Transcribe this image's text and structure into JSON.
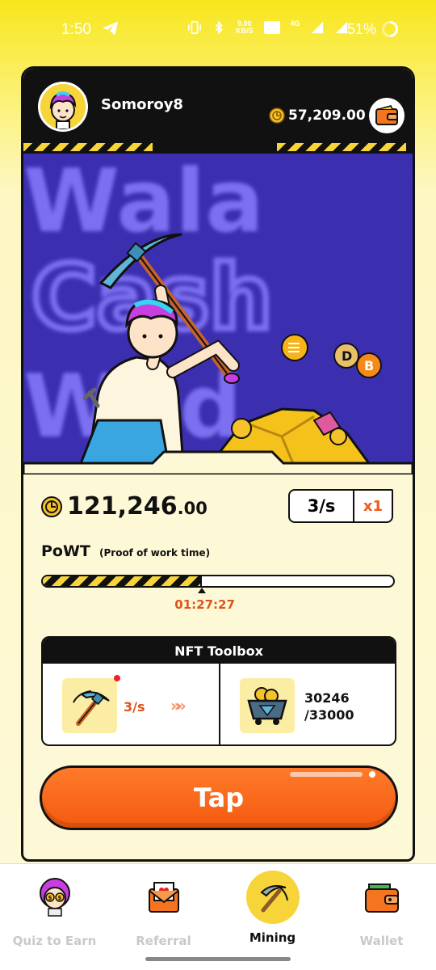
{
  "status_bar": {
    "time": "1:50",
    "net_speed_value": "9.00",
    "net_speed_unit": "KB/S",
    "signal": "4G",
    "battery": "51%"
  },
  "header": {
    "username": "Somoroy8",
    "balance": "57,209.00"
  },
  "hero": {
    "background_text": [
      "Wala",
      "Cash",
      "Wild"
    ]
  },
  "mining": {
    "mined_integer": "121,246",
    "mined_decimal": ".00",
    "rate": "3/s",
    "multiplier": "x1"
  },
  "powt": {
    "title": "PoWT",
    "subtitle": "(Proof of work time)",
    "progress_fraction": 0.455,
    "time_remaining": "01:27:27"
  },
  "toolbox": {
    "title": "NFT Toolbox",
    "tool_rate": "3/s",
    "arrows": "»»",
    "capacity_current": "30246",
    "capacity_max": "/33000"
  },
  "tap_label": "Tap",
  "nav": [
    {
      "label": "Quiz to Earn",
      "icon": "quiz-avatar-icon",
      "active": false
    },
    {
      "label": "Referral",
      "icon": "referral-envelope-icon",
      "active": false
    },
    {
      "label": "Mining",
      "icon": "pickaxe-icon",
      "active": true
    },
    {
      "label": "Wallet",
      "icon": "wallet-icon",
      "active": false
    }
  ],
  "colors": {
    "accent_yellow": "#f6d43a",
    "accent_orange": "#f45a0f",
    "hero_blue": "#3b2fb0",
    "card_bg": "#fdf8d6"
  }
}
